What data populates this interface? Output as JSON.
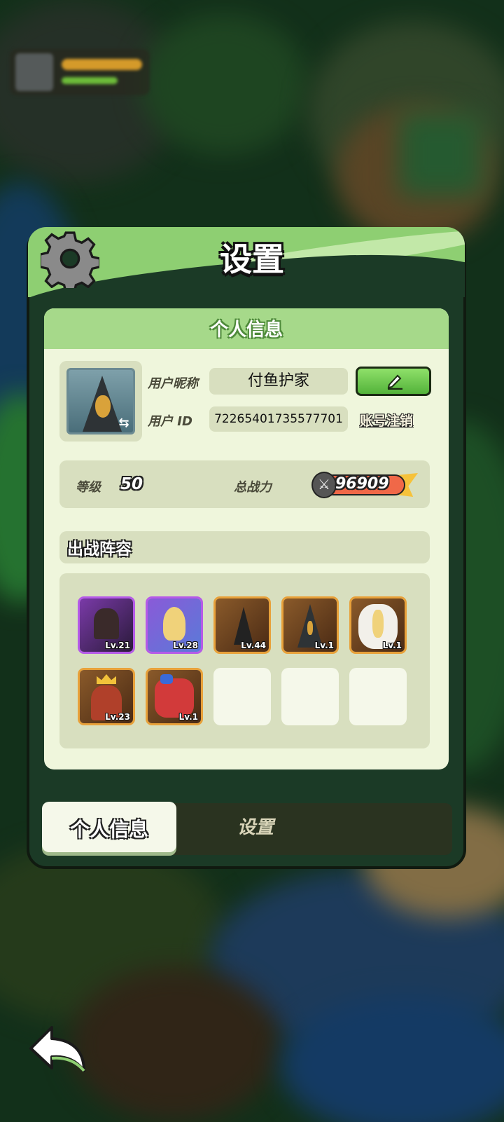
{
  "panel": {
    "title": "设置",
    "icon": "gear-icon"
  },
  "profile": {
    "section_title": "个人信息",
    "nickname_label": "用户昵称",
    "nickname_value": "付鱼护家",
    "id_label": "用户  ID",
    "id_value": "72265401735577701",
    "edit_icon": "pencil-icon",
    "cancel_account_label": "账号注销",
    "level_label": "等级",
    "level_value": "50",
    "power_label": "总战力",
    "power_value": "96909"
  },
  "lineup": {
    "title": "出战阵容",
    "heroes": [
      {
        "level": "Lv.21",
        "frame": "purple"
      },
      {
        "level": "Lv.28",
        "frame": "purple"
      },
      {
        "level": "Lv.44",
        "frame": "gold"
      },
      {
        "level": "Lv.1",
        "frame": "gold"
      },
      {
        "level": "Lv.1",
        "frame": "gold"
      },
      {
        "level": "Lv.23",
        "frame": "gold"
      },
      {
        "level": "Lv.1",
        "frame": "gold"
      }
    ],
    "empty_slots": 3
  },
  "tabs": [
    {
      "label": "个人信息",
      "active": true
    },
    {
      "label": "设置",
      "active": false
    }
  ],
  "colors": {
    "accent_green": "#8ecf72",
    "panel_dark": "#1b3a26",
    "card_light": "#eff6dc",
    "gold_frame": "#e8a13a",
    "purple_frame": "#b55ae8"
  }
}
